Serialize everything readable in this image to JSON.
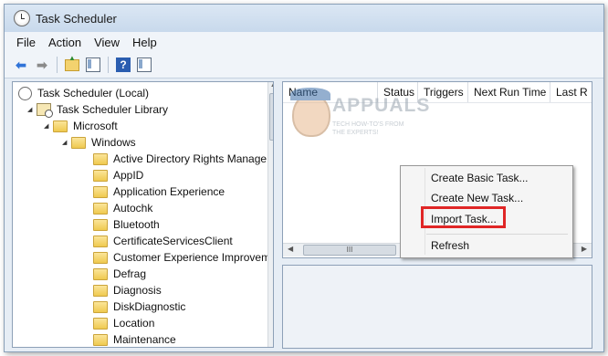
{
  "window": {
    "title": "Task Scheduler"
  },
  "menubar": {
    "items": [
      "File",
      "Action",
      "View",
      "Help"
    ]
  },
  "toolbar": {
    "buttons": [
      "back-icon",
      "forward-icon",
      "up-folder-icon",
      "show-hide-pane-icon",
      "help-icon",
      "properties-pane-icon"
    ]
  },
  "tree": {
    "root": "Task Scheduler (Local)",
    "library": "Task Scheduler Library",
    "microsoft": "Microsoft",
    "windows": "Windows",
    "items": [
      "Active Directory Rights Manage",
      "AppID",
      "Application Experience",
      "Autochk",
      "Bluetooth",
      "CertificateServicesClient",
      "Customer Experience Improvem",
      "Defrag",
      "Diagnosis",
      "DiskDiagnostic",
      "Location",
      "Maintenance"
    ]
  },
  "list": {
    "columns": [
      "Name",
      "Status",
      "Triggers",
      "Next Run Time",
      "Last R"
    ],
    "scroll_glyph": "III"
  },
  "context_menu": {
    "items": [
      "Create Basic Task...",
      "Create New Task...",
      "Import Task...",
      "Refresh"
    ]
  },
  "watermark": {
    "brand": "APPUALS",
    "tagline": "TECH HOW-TO'S FROM THE EXPERTS!"
  },
  "colors": {
    "highlight": "#e02626",
    "accent": "#2f73d8"
  }
}
